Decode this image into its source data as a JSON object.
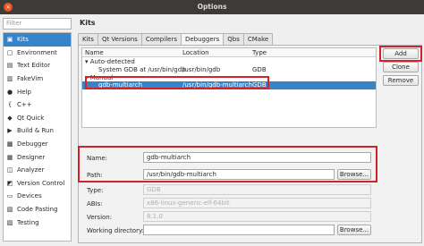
{
  "window": {
    "title": "Options",
    "close_glyph": "×"
  },
  "filter": {
    "placeholder": "Filter"
  },
  "sidebar": {
    "items": [
      {
        "label": "Kits",
        "icon": "kits-icon",
        "glyph": "▣",
        "selected": true
      },
      {
        "label": "Environment",
        "icon": "environment-icon",
        "glyph": "▢"
      },
      {
        "label": "Text Editor",
        "icon": "text-editor-icon",
        "glyph": "▤"
      },
      {
        "label": "FakeVim",
        "icon": "fakevim-icon",
        "glyph": "▥"
      },
      {
        "label": "Help",
        "icon": "help-icon",
        "glyph": "●"
      },
      {
        "label": "C++",
        "icon": "cpp-icon",
        "glyph": "{"
      },
      {
        "label": "Qt Quick",
        "icon": "qt-quick-icon",
        "glyph": "◆"
      },
      {
        "label": "Build & Run",
        "icon": "build-run-icon",
        "glyph": "▶"
      },
      {
        "label": "Debugger",
        "icon": "debugger-icon",
        "glyph": "▩"
      },
      {
        "label": "Designer",
        "icon": "designer-icon",
        "glyph": "▦"
      },
      {
        "label": "Analyzer",
        "icon": "analyzer-icon",
        "glyph": "◫"
      },
      {
        "label": "Version Control",
        "icon": "version-control-icon",
        "glyph": "◩"
      },
      {
        "label": "Devices",
        "icon": "devices-icon",
        "glyph": "▭"
      },
      {
        "label": "Code Pasting",
        "icon": "code-pasting-icon",
        "glyph": "▧"
      },
      {
        "label": "Testing",
        "icon": "testing-icon",
        "glyph": "▨"
      }
    ]
  },
  "page": {
    "heading": "Kits"
  },
  "tabs": [
    {
      "label": "Kits",
      "active": false
    },
    {
      "label": "Qt Versions",
      "active": false
    },
    {
      "label": "Compilers",
      "active": false
    },
    {
      "label": "Debuggers",
      "active": true
    },
    {
      "label": "Qbs",
      "active": false
    },
    {
      "label": "CMake",
      "active": false
    }
  ],
  "tree": {
    "columns": [
      "Name",
      "Location",
      "Type"
    ],
    "auto_group": "▾ Auto-detected",
    "auto_rows": [
      {
        "name": "System GDB at /usr/bin/gdb",
        "location": "/usr/bin/gdb",
        "type": "GDB"
      }
    ],
    "manual_group": "▾ Manual",
    "manual_rows": [
      {
        "name": "gdb-multiarch",
        "location": "/usr/bin/gdb-multiarch",
        "type": "GDB"
      }
    ]
  },
  "buttons": {
    "add": "Add",
    "clone": "Clone",
    "remove": "Remove",
    "browse": "Browse...",
    "browse2": "Browse..."
  },
  "form": {
    "name_label": "Name:",
    "name_value": "gdb-multiarch",
    "path_label": "Path:",
    "path_value": "/usr/bin/gdb-multiarch",
    "type_label": "Type:",
    "type_value": "GDB",
    "abis_label": "ABIs:",
    "abis_value": "x86-linux-generic-elf-64bit",
    "version_label": "Version:",
    "version_value": "8.1.0",
    "workdir_label": "Working directory:",
    "workdir_value": ""
  },
  "colors": {
    "selection": "#3584c9",
    "highlight_box": "#d6202a",
    "titlebar": "#3c3b37"
  }
}
